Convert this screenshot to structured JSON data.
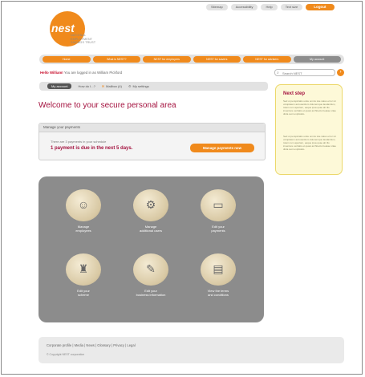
{
  "topnav": {
    "links": [
      "Sitemap",
      "Accessibility",
      "Help",
      "Text size"
    ],
    "logout": "Logout"
  },
  "logo": {
    "text": "nest",
    "tagline": [
      "NATIONAL",
      "EMPLOYMENT",
      "SAVINGS TRUST"
    ]
  },
  "mainnav": [
    "Home",
    "What is NEST?",
    "NEST for employers",
    "NEST for savers",
    "NEST for advisers",
    "My account"
  ],
  "header": {
    "hello_name": "Hello William!",
    "hello_rest": "You are logged in as William Pickford"
  },
  "search": {
    "placeholder": "Search NEST",
    "go": "›"
  },
  "subtabs": [
    {
      "label": "My account"
    },
    {
      "label": "How do I...?"
    },
    {
      "label": "Mailbox (4)"
    },
    {
      "label": "My settings"
    }
  ],
  "welcome": "Welcome to your secure personal area",
  "payments": {
    "heading": "Manage your payments",
    "info": "There are 3 payments in your schedule",
    "due": "1 payment is due in the next 5 days.",
    "button": "Manage payments now"
  },
  "nextstep": {
    "title": "Next step",
    "p1": "Sed ut perspiciatis unde omnis iste natus error sit voluptatem accusantium doloremque laudantium, totam rem aperiam, eaque ipsa quae ab illo inventore veritatis et quasi architecto beatae vitae dicta sunt explicabo.",
    "p2": "Sed ut perspiciatis unde omnis iste natus error sit voluptatem accusantium doloremque laudantium, totam rem aperiam, eaque ipsa quae ab illo inventore veritatis et quasi architecto beatae vitae dicta sunt explicabo."
  },
  "tiles": [
    {
      "l1": "Manage",
      "l2": "employees",
      "icon": "employee-icon"
    },
    {
      "l1": "Manage",
      "l2": "additional users",
      "icon": "users-settings-icon"
    },
    {
      "l1": "Edit your",
      "l2": "payments",
      "icon": "card-icon"
    },
    {
      "l1": "Edit your",
      "l2": "scheme",
      "icon": "scheme-icon"
    },
    {
      "l1": "Edit your",
      "l2": "business information",
      "icon": "notepad-icon"
    },
    {
      "l1": "View the terms",
      "l2": "and conditions",
      "icon": "document-icon"
    }
  ],
  "footer": {
    "links": "Corporate profile | Media | News | Glossary | Privacy | Legal",
    "copyright": "© Copyright NEST corporation"
  }
}
